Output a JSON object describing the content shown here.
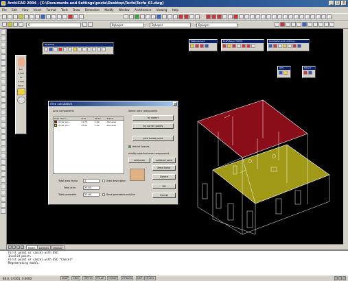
{
  "window": {
    "title": "ArchiCAD 2004 - [C:\\Documents and Settings\\poste\\Desktop\\Tecfa\\Tecfa_01.dwg]",
    "controls": [
      "_",
      "□",
      "x"
    ]
  },
  "menu": [
    "File",
    "Edit",
    "View",
    "Insert",
    "Format",
    "Tools",
    "Draw",
    "Dimension",
    "Modify",
    "Window",
    "Architecture",
    "Viewing",
    "Help"
  ],
  "toolbar2": {
    "layer_combo": "0",
    "color_combo": "ByLayer",
    "linetype_combo": "ByLayer",
    "lineweight_combo": "ByLayer"
  },
  "floating_toolbars": {
    "tecfa": "TecfaCAD",
    "measurement": "Measurement",
    "drafting": "Draft/Spigot WPHD",
    "annotation": "Annotation and control p...",
    "acs": "ACS",
    "object": "Object"
  },
  "side_panel": {
    "values": [
      "Lun",
      "0.000",
      "Ht",
      "0.000",
      "Paper"
    ]
  },
  "dialog": {
    "title": "Area calculation",
    "area_components_label": "Area components",
    "columns": [
      "Area descri...",
      "Area",
      "Factor",
      "Status"
    ],
    "rows": [
      {
        "name": "corner pro...",
        "area": "11.73",
        "factor": "1.00",
        "status": "Add area",
        "color": "#c00000"
      },
      {
        "name": "corner pro...",
        "area": "13.90",
        "factor": "1.00",
        "status": "Add area",
        "color": "#e8d800"
      }
    ],
    "select_label": "Select area components",
    "btn_by_object": "by object",
    "btn_by_corner": "by corner points",
    "btn_pick": "pick inside point",
    "detect_islands": "detect islands",
    "modify_label": "modify selected area components",
    "btn_add_area": "add area",
    "btn_subtract_area": "subtract area",
    "btn_area_factor": "Area factor",
    "btn_delete": "Delete",
    "total_area_factor_label": "Total area factor",
    "total_area_factor_value": "1",
    "area_description_label": "Area description",
    "total_area_label": "Total area",
    "total_area_value": "25.63",
    "total_perimeter_label": "Total perimeter",
    "total_perimeter_value": "21.60",
    "save_polyline": "Save perimeter polyline",
    "btn_ok": "OK",
    "btn_cancel": "Cancel"
  },
  "tabs": [
    "Model",
    "Layout1",
    "Layout2"
  ],
  "command_lines": [
    "First point or cancel with ESC",
    "Invalid point.",
    "First point or cancel with ESC *Cancel*",
    "Regenerating model."
  ],
  "status": {
    "coords": "88.8, 0.0301, 0.0000",
    "buttons": [
      "SNAP",
      "GRID",
      "ORTHO",
      "POLAR",
      "OSNAP",
      "OTRACK",
      "LWT",
      "MODEL"
    ]
  }
}
